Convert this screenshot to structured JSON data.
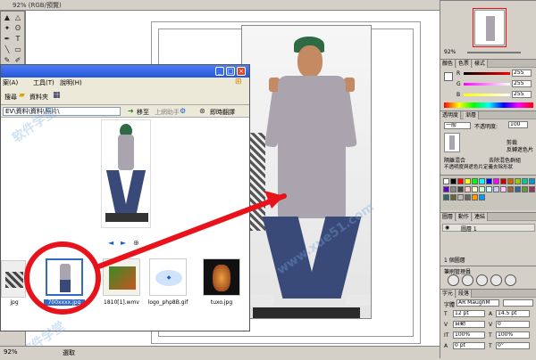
{
  "app": {
    "title": "92% (RGB/預覽)",
    "zoom": "92%",
    "status_text": "選取"
  },
  "explorer": {
    "menu": [
      "案(A)",
      "工具(T)",
      "說明(H)"
    ],
    "toolbar": {
      "search_label": "搜尋",
      "folders_label": "資料夾"
    },
    "address": "EV\\資料\\資料\\照片\\",
    "go_label": "移至",
    "links_label": "上網助手",
    "extra_label": "即時翻譯",
    "files": [
      {
        "name": "jpg"
      },
      {
        "name": "700xxxx.jpg"
      },
      {
        "name": "1810[1].wmv"
      },
      {
        "name": "logo_php8B.gif"
      },
      {
        "name": "tuxo.jpg"
      }
    ]
  },
  "panels": {
    "navigator": {
      "zoom": "92%"
    },
    "color": {
      "tabs": [
        "顏色",
        "色票",
        "樣式"
      ],
      "r": "255",
      "g": "255",
      "b": "255"
    },
    "layers": {
      "tabs": [
        "透明度",
        "漸層"
      ],
      "mode": "一般",
      "opacity_label": "不透明度:",
      "opacity": "100",
      "checkbox1": "剪裁",
      "checkbox2": "反轉遮色片",
      "checkbox3": "隔離混合",
      "checkbox4": "去除混色群組",
      "checkbox5": "不透明度與遮色片定義去除形狀"
    },
    "layer_list": {
      "tabs": [
        "圖層",
        "動作",
        "連結"
      ],
      "layer_name": "圖層 1",
      "footer": "1 個圖層"
    },
    "brushes": {
      "title": "筆刷管理員"
    },
    "character": {
      "tabs": [
        "字元",
        "段落"
      ],
      "font_label": "字體",
      "font": "AR MaughM",
      "size": "12 pt",
      "leading": "14.5 pt",
      "kerning": "自動",
      "tracking": "0",
      "h_scale": "100%",
      "v_scale": "100%",
      "baseline": "0 pt",
      "rotation": "0°"
    }
  },
  "accent": {
    "title_blue": "#2456d9",
    "annotation_red": "#e8121a",
    "green_hat": "#2e6b45",
    "jeans": "#3a4a78"
  },
  "watermarks": {
    "text_cn": "软件学堂",
    "text_url": "www.xue51.com"
  }
}
